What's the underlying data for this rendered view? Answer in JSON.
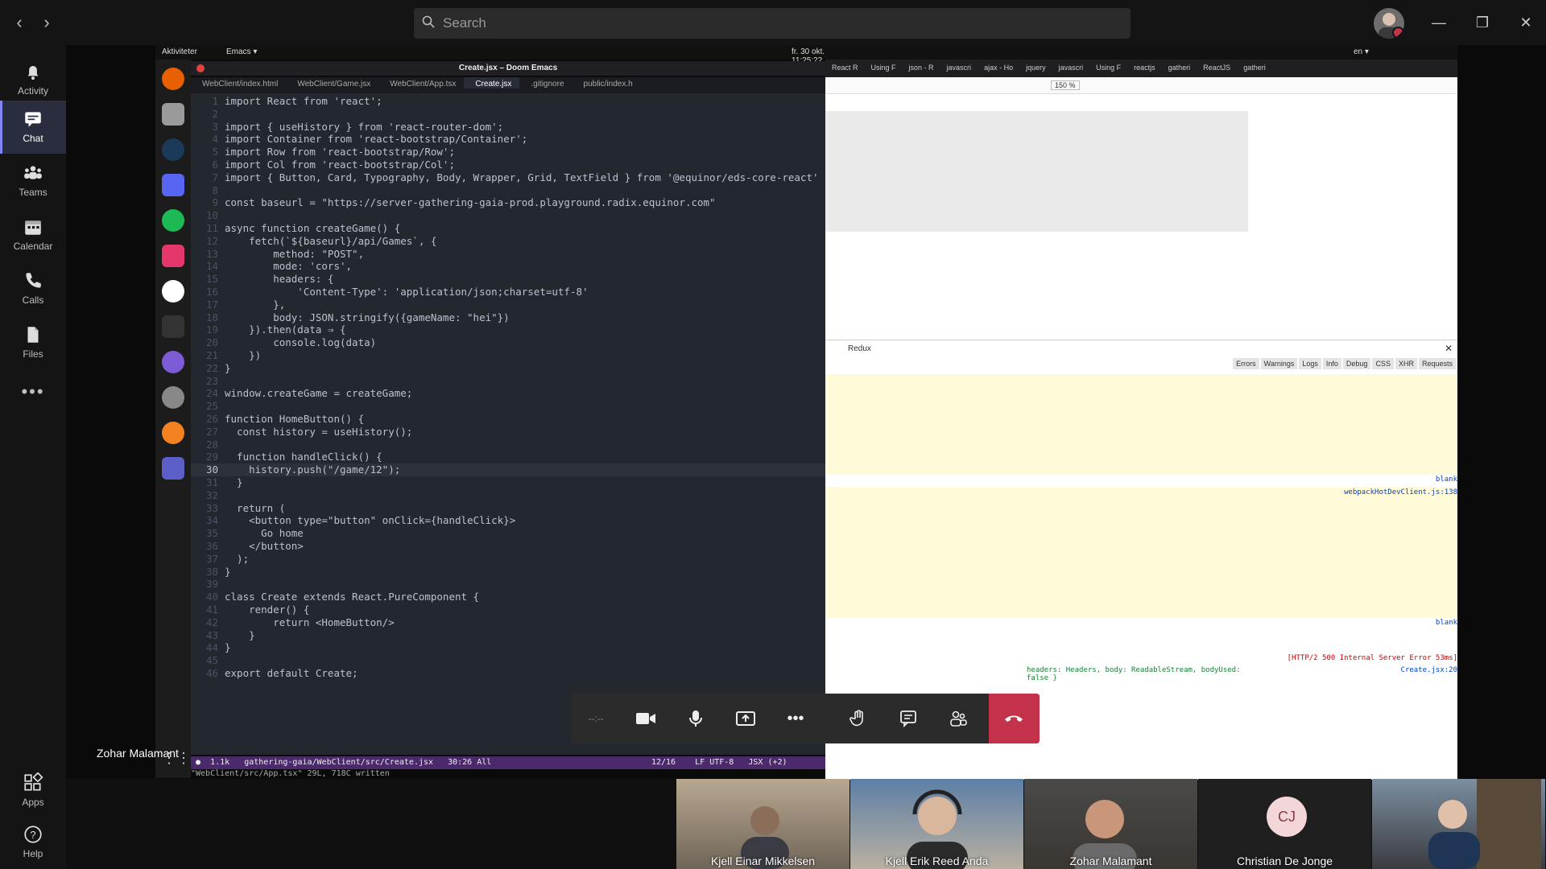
{
  "header": {
    "search_placeholder": "Search"
  },
  "rail": {
    "items": [
      {
        "label": "Activity",
        "icon": "bell-icon"
      },
      {
        "label": "Chat",
        "icon": "chat-icon"
      },
      {
        "label": "Teams",
        "icon": "teams-icon"
      },
      {
        "label": "Calendar",
        "icon": "calendar-icon"
      },
      {
        "label": "Calls",
        "icon": "phone-icon"
      },
      {
        "label": "Files",
        "icon": "files-icon"
      }
    ],
    "bottom": [
      {
        "label": "Apps",
        "icon": "apps-icon"
      },
      {
        "label": "Help",
        "icon": "help-icon"
      }
    ]
  },
  "desktop": {
    "activities_label": "Aktiviteter",
    "app_menu": "Emacs ▾",
    "clock": "fr. 30 okt. 11:25:22",
    "lang": "en ▾"
  },
  "emacs": {
    "title": "Create.jsx – Doom Emacs",
    "tabs": [
      "WebClient/index.html",
      "WebClient/Game.jsx",
      "WebClient/App.tsx",
      "Create.jsx",
      ".gitignore",
      "public/index.h"
    ],
    "active_tab": 3,
    "current_line": 30,
    "lines": [
      {
        "n": "1",
        "t": "import React from 'react';"
      },
      {
        "n": "2",
        "t": ""
      },
      {
        "n": "3",
        "t": "import { useHistory } from 'react-router-dom';"
      },
      {
        "n": "4",
        "t": "import Container from 'react-bootstrap/Container';"
      },
      {
        "n": "5",
        "t": "import Row from 'react-bootstrap/Row';"
      },
      {
        "n": "6",
        "t": "import Col from 'react-bootstrap/Col';"
      },
      {
        "n": "7",
        "t": "import { Button, Card, Typography, Body, Wrapper, Grid, TextField } from '@equinor/eds-core-react'"
      },
      {
        "n": "8",
        "t": ""
      },
      {
        "n": "9",
        "t": "const baseurl = \"https://server-gathering-gaia-prod.playground.radix.equinor.com\""
      },
      {
        "n": "10",
        "t": ""
      },
      {
        "n": "11",
        "t": "async function createGame() {"
      },
      {
        "n": "12",
        "t": "    fetch(`${baseurl}/api/Games`, {"
      },
      {
        "n": "13",
        "t": "        method: \"POST\","
      },
      {
        "n": "14",
        "t": "        mode: 'cors',"
      },
      {
        "n": "15",
        "t": "        headers: {"
      },
      {
        "n": "16",
        "t": "            'Content-Type': 'application/json;charset=utf-8'"
      },
      {
        "n": "17",
        "t": "        },"
      },
      {
        "n": "18",
        "t": "        body: JSON.stringify({gameName: \"hei\"})"
      },
      {
        "n": "19",
        "t": "    }).then(data ⇒ {"
      },
      {
        "n": "20",
        "t": "        console.log(data)"
      },
      {
        "n": "21",
        "t": "    })"
      },
      {
        "n": "22",
        "t": "}"
      },
      {
        "n": "23",
        "t": ""
      },
      {
        "n": "24",
        "t": "window.createGame = createGame;"
      },
      {
        "n": "25",
        "t": ""
      },
      {
        "n": "26",
        "t": "function HomeButton() {"
      },
      {
        "n": "27",
        "t": "  const history = useHistory();"
      },
      {
        "n": "28",
        "t": ""
      },
      {
        "n": "29",
        "t": "  function handleClick() {"
      },
      {
        "n": "30",
        "t": "    history.push(\"/game/12\");"
      },
      {
        "n": "31",
        "t": "  }"
      },
      {
        "n": "32",
        "t": ""
      },
      {
        "n": "33",
        "t": "  return ("
      },
      {
        "n": "34",
        "t": "    <button type=\"button\" onClick={handleClick}>"
      },
      {
        "n": "35",
        "t": "      Go home"
      },
      {
        "n": "36",
        "t": "    </button>"
      },
      {
        "n": "37",
        "t": "  );"
      },
      {
        "n": "38",
        "t": "}"
      },
      {
        "n": "39",
        "t": ""
      },
      {
        "n": "40",
        "t": "class Create extends React.PureComponent {"
      },
      {
        "n": "41",
        "t": "    render() {"
      },
      {
        "n": "42",
        "t": "        return <HomeButton/>"
      },
      {
        "n": "43",
        "t": "    }"
      },
      {
        "n": "44",
        "t": "}"
      },
      {
        "n": "45",
        "t": ""
      },
      {
        "n": "46",
        "t": "export default Create;"
      }
    ],
    "modeline": " ●  1.1k   gathering-gaia/WebClient/src/Create.jsx   30:26 All                                 12/16    LF UTF-8   JSX (+2) ",
    "echo": "\"WebClient/src/App.tsx\" 29L, 718C written"
  },
  "browser": {
    "tabs": [
      "React R",
      "Using F",
      "json - R",
      "javascri",
      "ajax - Ho",
      "jquery",
      "javascri",
      "Using F",
      "reactjs",
      "gatheri",
      "ReactJS",
      "gatheri"
    ],
    "zoom": "150 %",
    "devtools": {
      "panel_title": "Redux",
      "filters": [
        "Errors",
        "Warnings",
        "Logs",
        "Info",
        "Debug",
        "CSS",
        "XHR",
        "Requests"
      ],
      "blank1": "blank",
      "source1": "webpackHotDevClient.js:138",
      "blank2": "blank",
      "error_status": "[HTTP/2 500 Internal Server Error 53ms]",
      "log_line": "headers: Headers, body: ReadableStream, bodyUsed: false }",
      "log_source": "Create.jsx:20"
    }
  },
  "call": {
    "timer": "--:--",
    "presenter_name": "Zohar Malamant"
  },
  "participants": [
    {
      "name": "Kjell Einar Mikkelsen"
    },
    {
      "name": "Kjell Erik Reed Anda"
    },
    {
      "name": "Zohar Malamant"
    },
    {
      "name": "Christian De Jonge",
      "initials": "CJ"
    },
    {
      "name": ""
    }
  ]
}
